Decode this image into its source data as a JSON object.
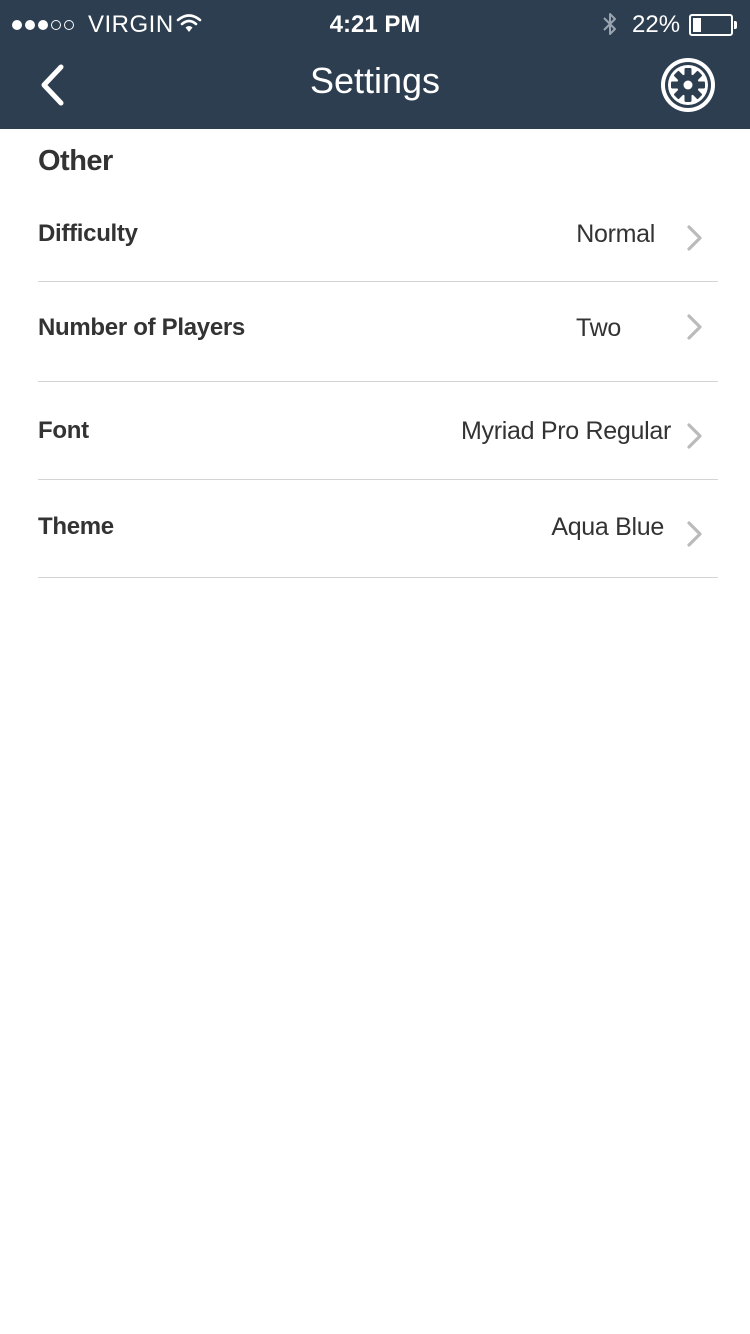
{
  "status_bar": {
    "carrier": "VIRGIN",
    "time": "4:21 PM",
    "battery_percent_label": "22%",
    "battery_level": 0.22
  },
  "nav": {
    "title": "Settings",
    "back_icon": "chevron-left-icon",
    "settings_icon": "gear-icon"
  },
  "section": {
    "title": "Other"
  },
  "rows": [
    {
      "label": "Difficulty",
      "value": "Normal"
    },
    {
      "label": "Number of Players",
      "value": "Two"
    },
    {
      "label": "Font",
      "value": "Myriad Pro Regular"
    },
    {
      "label": "Theme",
      "value": "Aqua Blue"
    }
  ],
  "colors": {
    "header_bg": "#2d3e50",
    "text": "#333333",
    "divider": "#d4d4d4",
    "chevron": "#bbbbbb"
  }
}
